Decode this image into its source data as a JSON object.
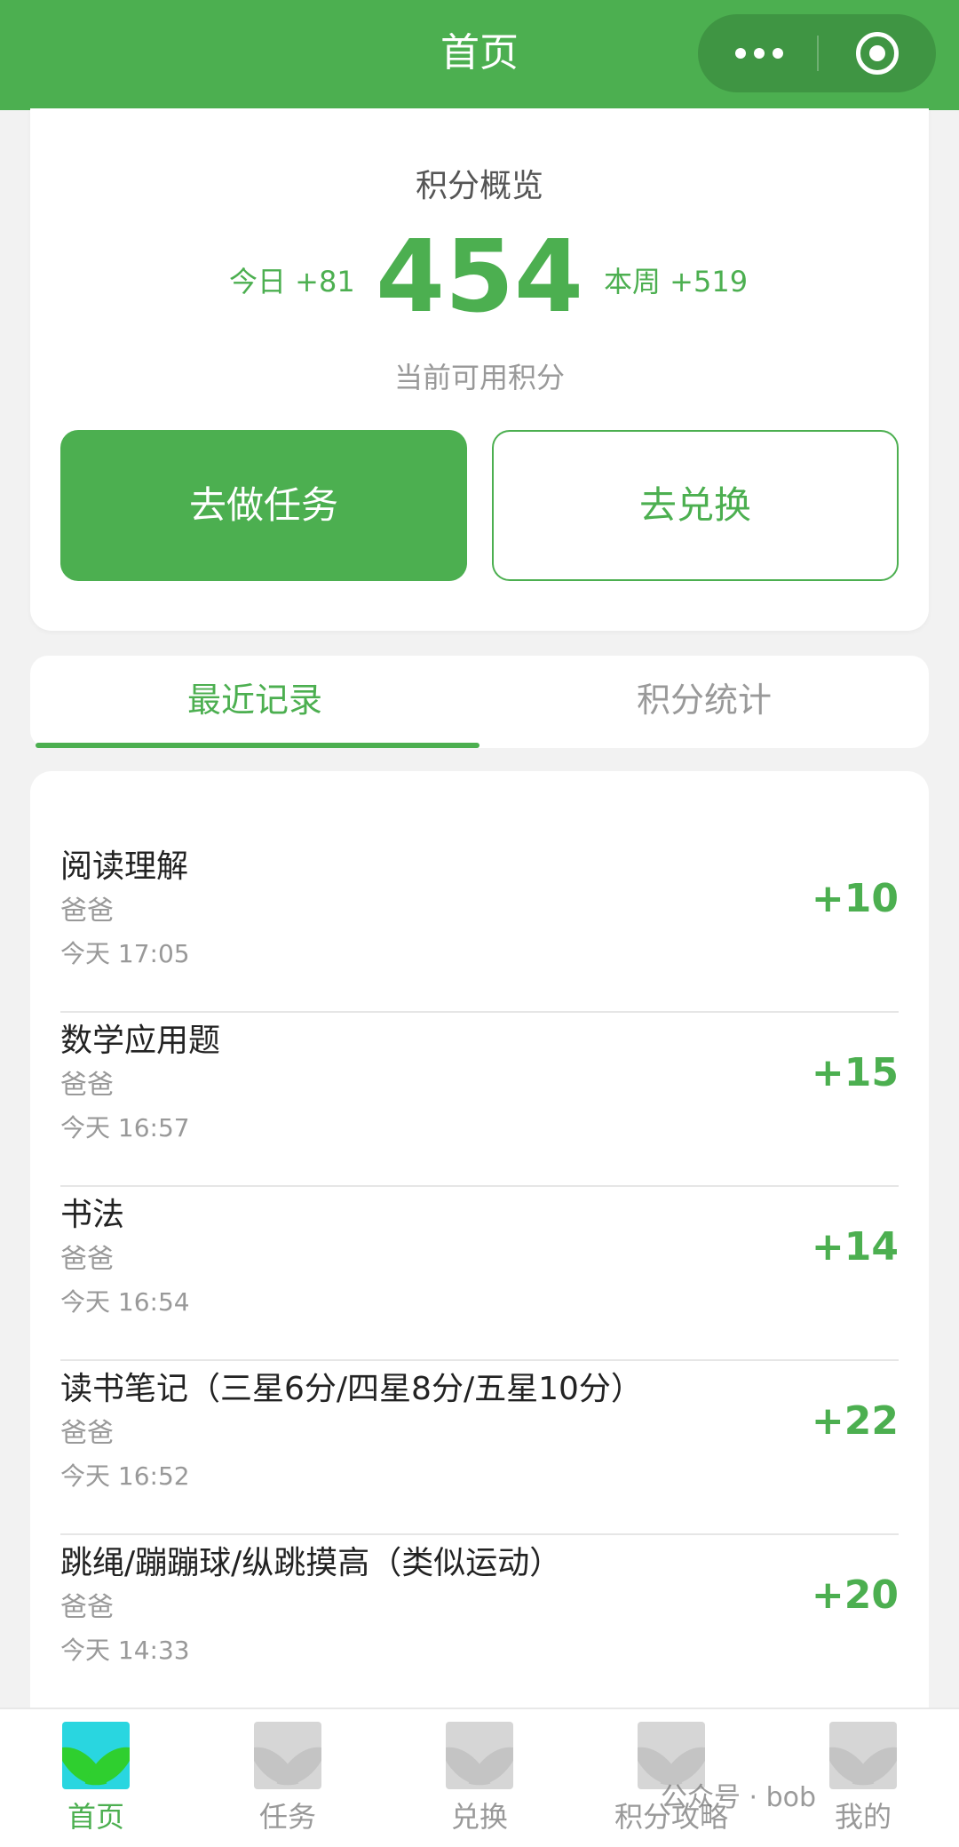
{
  "header": {
    "title": "首页"
  },
  "summary": {
    "title": "积分概览",
    "today": "今日 +81",
    "points": "454",
    "week": "本周 +519",
    "points_label": "当前可用积分",
    "task_button": "去做任务",
    "redeem_button": "去兑换"
  },
  "tabs": {
    "recent": "最近记录",
    "stats": "积分统计"
  },
  "records": [
    {
      "title": "阅读理解",
      "by": "爸爸",
      "time": "今天 17:05",
      "points": "+10"
    },
    {
      "title": "数学应用题",
      "by": "爸爸",
      "time": "今天 16:57",
      "points": "+15"
    },
    {
      "title": "书法",
      "by": "爸爸",
      "time": "今天 16:54",
      "points": "+14"
    },
    {
      "title": "读书笔记（三星6分/四星8分/五星10分）",
      "by": "爸爸",
      "time": "今天 16:52",
      "points": "+22"
    },
    {
      "title": "跳绳/蹦蹦球/纵跳摸高（类似运动）",
      "by": "爸爸",
      "time": "今天 14:33",
      "points": "+20"
    }
  ],
  "tabbar": {
    "items": [
      {
        "label": "首页",
        "icon": "home-icon",
        "active": true
      },
      {
        "label": "任务",
        "icon": "task-icon",
        "active": false
      },
      {
        "label": "兑换",
        "icon": "redeem-icon",
        "active": false
      },
      {
        "label": "积分攻略",
        "icon": "guide-icon",
        "active": false
      },
      {
        "label": "我的",
        "icon": "profile-icon",
        "active": false
      }
    ]
  },
  "watermark": "公众号 · bob",
  "colors": {
    "accent": "#4caf50",
    "header_bg": "#4caf50",
    "active_icon_bg": "#29d6e0"
  }
}
